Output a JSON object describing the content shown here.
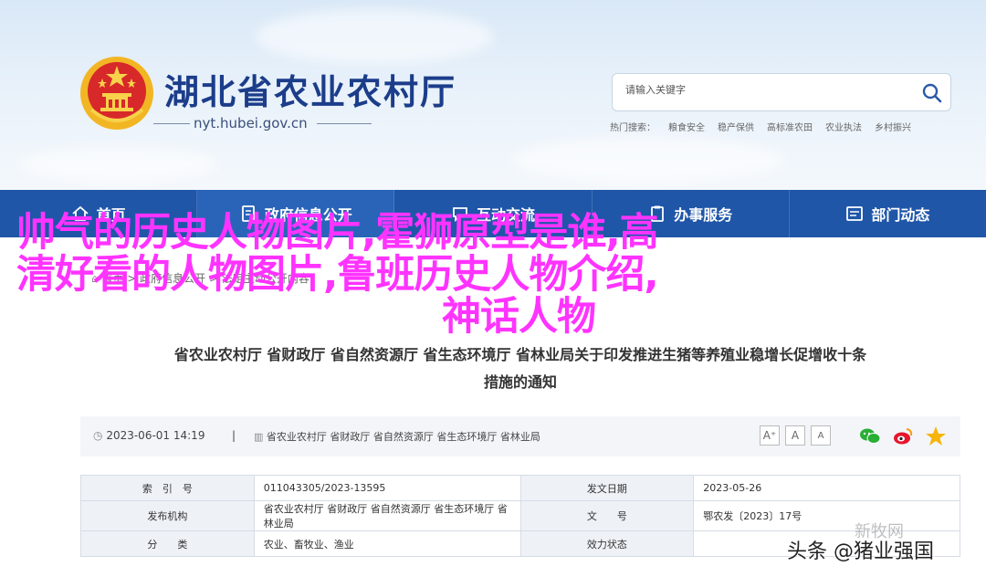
{
  "header": {
    "site_title": "湖北省农业农村厅",
    "site_url": "nyt.hubei.gov.cn"
  },
  "search": {
    "placeholder": "请输入关键字",
    "hot_label": "热门搜索：",
    "hot_terms": [
      "粮食安全",
      "稳产保供",
      "高标准农田",
      "农业执法",
      "乡村振兴"
    ]
  },
  "nav": {
    "items": [
      {
        "label": "首页",
        "icon": "home-icon"
      },
      {
        "label": "政府信息公开",
        "icon": "document-icon"
      },
      {
        "label": "互动交流",
        "icon": "chat-icon"
      },
      {
        "label": "办事服务",
        "icon": "clipboard-icon"
      },
      {
        "label": "部门动态",
        "icon": "list-icon"
      }
    ]
  },
  "breadcrumb": {
    "text": "首页 > 政府信息公开 > 法定主动公开内容"
  },
  "article": {
    "title_line1": "省农业农村厅 省财政厅 省自然资源厅 省生态环境厅 省林业局关于印发推进生猪等养殖业稳增长促增收十条",
    "title_line2": "措施的通知",
    "date": "2023-06-01 14:19",
    "separator": "|",
    "sources": "省农业农村厅 省财政厅 省自然资源厅 省生态环境厅 省林业局"
  },
  "font_buttons": [
    "A⁺",
    "A",
    "A"
  ],
  "info_table": {
    "rows": [
      {
        "label1": "索　引　号",
        "value1": "011043305/2023-13595",
        "label2": "发文日期",
        "value2": "2023-05-26"
      },
      {
        "label1": "发布机构",
        "value1": "省农业农村厅 省财政厅 省自然资源厅 省生态环境厅 省林业局",
        "label2": "文　　号",
        "value2": "鄂农发〔2023〕17号"
      },
      {
        "label1": "分　　类",
        "value1": "农业、畜牧业、渔业",
        "label2": "效力状态",
        "value2": ""
      }
    ]
  },
  "overlay": {
    "line1": "帅气的历史人物图片,霍狮原型是谁,高",
    "line2": "清好看的人物图片,鲁班历史人物介绍,",
    "line3": "神话人物"
  },
  "watermark": {
    "faint": "新牧网",
    "main": "头条 @猪业强国"
  },
  "colors": {
    "nav_bg": "#1f56a8",
    "title_blue": "#1b3d8a",
    "overlay_magenta": "#ff33ff"
  }
}
